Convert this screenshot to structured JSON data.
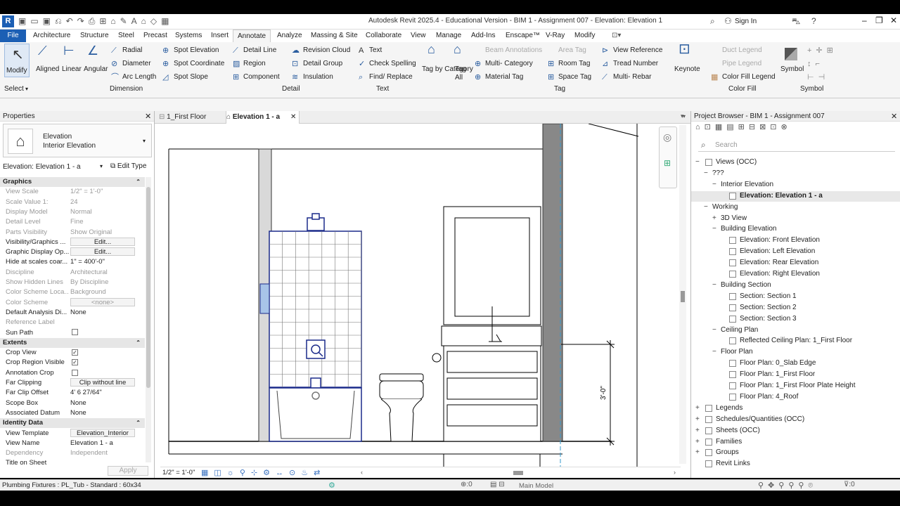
{
  "app": {
    "title": "Autodesk Revit 2025.4 - Educational Version - BIM 1 - Assignment 007 - Elevation: Elevation 1 - a",
    "sign_in": "Sign In"
  },
  "ribbon_tabs": [
    "File",
    "Architecture",
    "Structure",
    "Steel",
    "Precast",
    "Systems",
    "Insert",
    "Annotate",
    "Analyze",
    "Massing & Site",
    "Collaborate",
    "View",
    "Manage",
    "Add-Ins",
    "Enscape™",
    "V-Ray",
    "Modify"
  ],
  "ribbon": {
    "modify": "Modify",
    "select": "Select",
    "dimension": {
      "aligned": "Aligned",
      "linear": "Linear",
      "angular": "Angular",
      "radial": "Radial",
      "diameter": "Diameter",
      "arc_length": "Arc Length",
      "spot_elevation": "Spot Elevation",
      "spot_coordinate": "Spot Coordinate",
      "spot_slope": "Spot Slope",
      "panel": "Dimension"
    },
    "detail": {
      "detail_line": "Detail Line",
      "region": "Region",
      "component": "Component",
      "revision_cloud": "Revision Cloud",
      "detail_group": "Detail Group",
      "insulation": "Insulation",
      "panel": "Detail"
    },
    "text": {
      "text": "Text",
      "check_spelling": "Check Spelling",
      "find_replace": "Find/ Replace",
      "panel": "Text"
    },
    "tag": {
      "tag_by_category": "Tag by Category",
      "tag_all": "Tag All",
      "beam_annotations": "Beam Annotations",
      "multi_category": "Multi- Category",
      "material_tag": "Material Tag",
      "area_tag": "Area Tag",
      "room_tag": "Room Tag",
      "space_tag": "Space Tag",
      "view_reference": "View Reference",
      "tread_number": "Tread Number",
      "multi_rebar": "Multi- Rebar",
      "panel": "Tag"
    },
    "keynote": "Keynote",
    "color_fill": {
      "duct_legend": "Duct Legend",
      "pipe_legend": "Pipe Legend",
      "color_fill_legend": "Color Fill Legend",
      "panel": "Color Fill"
    },
    "symbol": {
      "symbol": "Symbol",
      "panel": "Symbol"
    }
  },
  "properties": {
    "title": "Properties",
    "type_name": "Elevation",
    "type_sub": "Interior Elevation",
    "selector": "Elevation: Elevation 1 - a",
    "edit_type": "Edit Type",
    "apply": "Apply",
    "rows": [
      {
        "k": "Graphics",
        "sec": true
      },
      {
        "k": "View Scale",
        "v": "1/2\" = 1'-0\"",
        "dis": true
      },
      {
        "k": "Scale Value    1:",
        "v": "24",
        "dis": true
      },
      {
        "k": "Display Model",
        "v": "Normal",
        "dis": true
      },
      {
        "k": "Detail Level",
        "v": "Fine",
        "dis": true
      },
      {
        "k": "Parts Visibility",
        "v": "Show Original",
        "dis": true
      },
      {
        "k": "Visibility/Graphics ...",
        "v": "Edit...",
        "btn": true
      },
      {
        "k": "Graphic Display Op...",
        "v": "Edit...",
        "btn": true
      },
      {
        "k": "Hide at scales coar...",
        "v": "1\" = 400'-0\""
      },
      {
        "k": "Discipline",
        "v": "Architectural",
        "dis": true
      },
      {
        "k": "Show Hidden Lines",
        "v": "By Discipline",
        "dis": true
      },
      {
        "k": "Color Scheme Loca...",
        "v": "Background",
        "dis": true
      },
      {
        "k": "Color Scheme",
        "v": "<none>",
        "dis": true,
        "btn": true
      },
      {
        "k": "Default Analysis Di...",
        "v": "None"
      },
      {
        "k": "Reference Label",
        "v": "",
        "dis": true
      },
      {
        "k": "Sun Path",
        "cb": ""
      },
      {
        "k": "Extents",
        "sec": true
      },
      {
        "k": "Crop View",
        "cb": "✓"
      },
      {
        "k": "Crop Region Visible",
        "cb": "✓"
      },
      {
        "k": "Annotation Crop",
        "cb": ""
      },
      {
        "k": "Far Clipping",
        "v": "Clip without line",
        "btn": true
      },
      {
        "k": "Far Clip Offset",
        "v": "4'  6 27/64\""
      },
      {
        "k": "Scope Box",
        "v": "None"
      },
      {
        "k": "Associated Datum",
        "v": "None"
      },
      {
        "k": "Identity Data",
        "sec": true
      },
      {
        "k": "View Template",
        "v": "Elevation_Interior",
        "btn": true
      },
      {
        "k": "View Name",
        "v": "Elevation 1 - a"
      },
      {
        "k": "Dependency",
        "v": "Independent",
        "dis": true
      },
      {
        "k": "Title on Sheet",
        "v": ""
      }
    ]
  },
  "doc_tabs": [
    "1_First Floor",
    "Elevation 1 - a"
  ],
  "view_bar": {
    "scale": "1/2\" = 1'-0\""
  },
  "drawing": {
    "dimension": "3'-0\""
  },
  "browser": {
    "title": "Project Browser - BIM 1 - Assignment 007",
    "search": "Search",
    "nodes": [
      {
        "t": "Views (OCC)",
        "lvl": 0,
        "exp": "−",
        "ic": true
      },
      {
        "t": "???",
        "lvl": 1,
        "exp": "−"
      },
      {
        "t": "Interior Elevation",
        "lvl": 2,
        "exp": "−"
      },
      {
        "t": "Elevation: Elevation 1 - a",
        "lvl": 3,
        "view": true,
        "sel": true
      },
      {
        "t": "Working",
        "lvl": 1,
        "exp": "−"
      },
      {
        "t": "3D View",
        "lvl": 2,
        "exp": "+"
      },
      {
        "t": "Building Elevation",
        "lvl": 2,
        "exp": "−"
      },
      {
        "t": "Elevation: Front Elevation",
        "lvl": 3,
        "view": true
      },
      {
        "t": "Elevation: Left Elevation",
        "lvl": 3,
        "view": true
      },
      {
        "t": "Elevation: Rear Elevation",
        "lvl": 3,
        "view": true
      },
      {
        "t": "Elevation: Right Elevation",
        "lvl": 3,
        "view": true
      },
      {
        "t": "Building Section",
        "lvl": 2,
        "exp": "−"
      },
      {
        "t": "Section: Section 1",
        "lvl": 3,
        "view": true
      },
      {
        "t": "Section: Section 2",
        "lvl": 3,
        "view": true
      },
      {
        "t": "Section: Section 3",
        "lvl": 3,
        "view": true
      },
      {
        "t": "Ceiling Plan",
        "lvl": 2,
        "exp": "−"
      },
      {
        "t": "Reflected Ceiling Plan: 1_First Floor",
        "lvl": 3,
        "view": true
      },
      {
        "t": "Floor Plan",
        "lvl": 2,
        "exp": "−"
      },
      {
        "t": "Floor Plan: 0_Slab Edge",
        "lvl": 3,
        "view": true
      },
      {
        "t": "Floor Plan: 1_First Floor",
        "lvl": 3,
        "view": true
      },
      {
        "t": "Floor Plan: 1_First Floor Plate Height",
        "lvl": 3,
        "view": true
      },
      {
        "t": "Floor Plan: 4_Roof",
        "lvl": 3,
        "view": true
      },
      {
        "t": "Legends",
        "lvl": 0,
        "exp": "+",
        "ic": true
      },
      {
        "t": "Schedules/Quantities (OCC)",
        "lvl": 0,
        "exp": "+",
        "ic": true
      },
      {
        "t": "Sheets (OCC)",
        "lvl": 0,
        "exp": "+",
        "ic": true
      },
      {
        "t": "Families",
        "lvl": 0,
        "exp": "+",
        "ic": true
      },
      {
        "t": "Groups",
        "lvl": 0,
        "exp": "+",
        "ic": true
      },
      {
        "t": "Revit Links",
        "lvl": 0,
        "exp": "",
        "ic": true
      }
    ]
  },
  "status": {
    "message": "Plumbing Fixtures : PL_Tub - Standard : 60x34",
    "count": ":0",
    "model": "Main Model",
    "filter": ":0"
  }
}
